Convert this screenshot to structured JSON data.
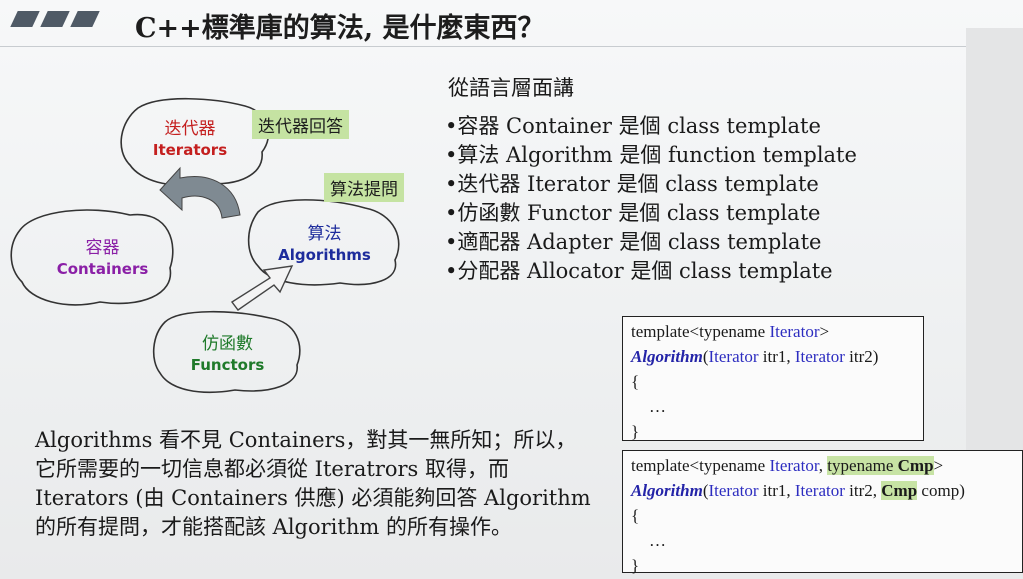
{
  "header": {
    "title": "C++標準庫的算法, 是什麼東西？"
  },
  "diagram": {
    "iterators": {
      "zh": "迭代器",
      "en": "Iterators"
    },
    "containers": {
      "zh": "容器",
      "en": "Containers"
    },
    "algorithms": {
      "zh": "算法",
      "en": "Algorithms"
    },
    "functors": {
      "zh": "仿函數",
      "en": "Functors"
    },
    "tag_answer": "迭代器回答",
    "tag_question": "算法提問",
    "colors": {
      "iterators": "#c41f1f",
      "containers": "#8a1fa6",
      "algorithms": "#1d2c9c",
      "functors": "#1f7a2a"
    }
  },
  "language_level": {
    "heading": "從語言層面講",
    "bullets": [
      "•容器 Container 是個 class template",
      "•算法 Algorithm 是個 function template",
      "•迭代器 Iterator 是個 class template",
      "•仿函數 Functor 是個 class template",
      "•適配器 Adapter 是個 class template",
      "•分配器 Allocator 是個 class template"
    ]
  },
  "paragraph": {
    "lines": [
      "Algorithms 看不見 Containers，對其一無所知；所以，",
      "它所需要的一切信息都必須從 Iteratrors 取得，而",
      "Iterators (由 Containers 供應) 必須能夠回答 Algorithm",
      "的所有提問，才能搭配該 Algorithm 的所有操作。"
    ]
  },
  "code1": {
    "l1a": "template<typename ",
    "l1b": "Iterator",
    "l1c": ">",
    "l2a": "Algorithm",
    "l2b": "(",
    "l2c": "Iterator",
    "l2d": " itr1, ",
    "l2e": "Iterator",
    "l2f": " itr2)",
    "l3": "{",
    "l4": "…",
    "l5": "}"
  },
  "code2": {
    "l1a": "template<typename ",
    "l1b": "Iterator",
    "l1c": ", ",
    "l1d": "typename ",
    "l1e": "Cmp",
    "l1f": ">",
    "l2a": "Algorithm",
    "l2b": "(",
    "l2c": "Iterator",
    "l2d": " itr1, ",
    "l2e": "Iterator",
    "l2f": " itr2, ",
    "l2g": "Cmp",
    "l2h": " comp)",
    "l3": "{",
    "l4": "…",
    "l5": "}"
  }
}
